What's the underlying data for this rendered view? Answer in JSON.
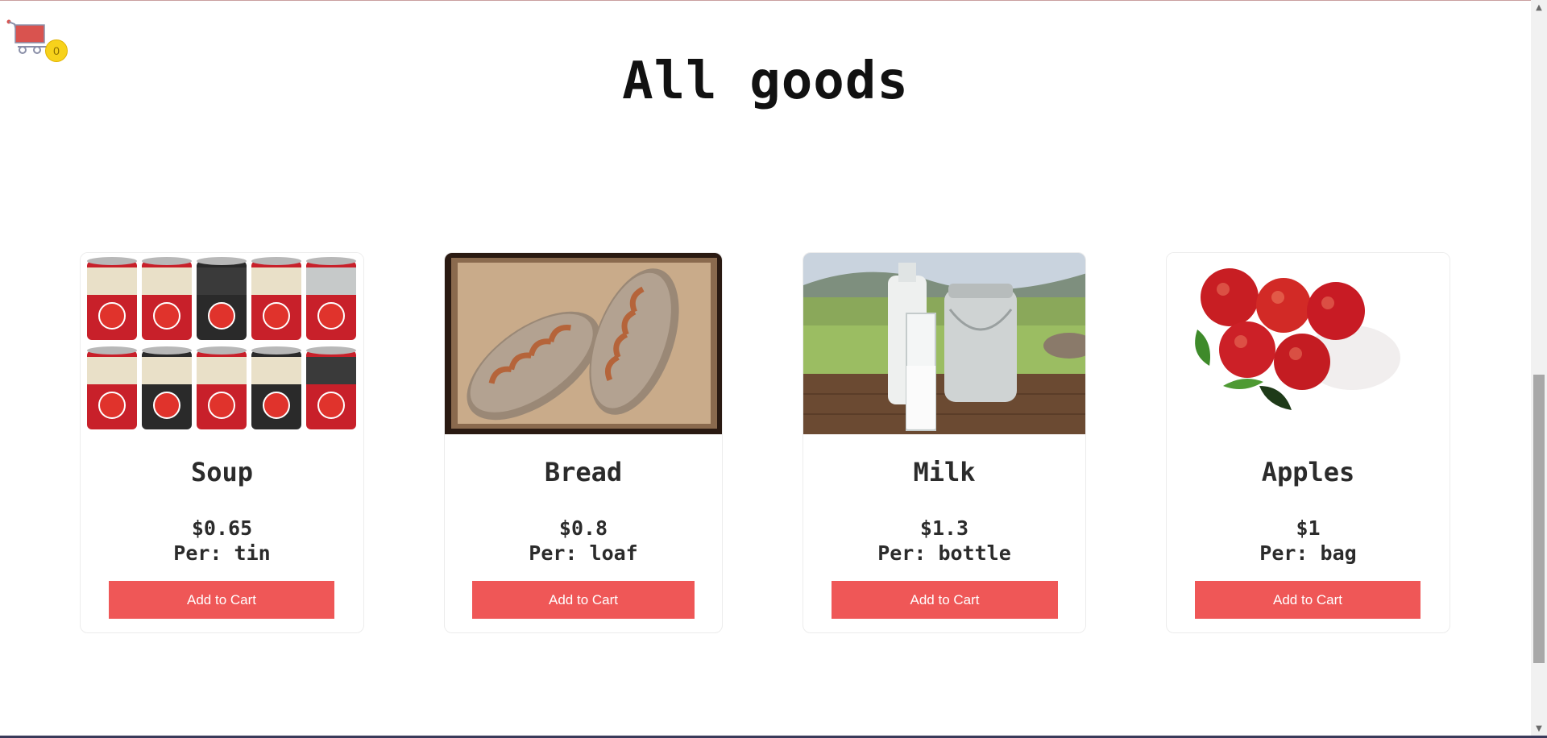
{
  "cart": {
    "count": "0",
    "icon": "shopping-cart-icon"
  },
  "page": {
    "title": "All goods"
  },
  "products": [
    {
      "name": "Soup",
      "price": "$0.65",
      "unit": "Per: tin",
      "button": "Add to Cart",
      "image": "tomato-soup-cans"
    },
    {
      "name": "Bread",
      "price": "$0.8",
      "unit": "Per: loaf",
      "button": "Add to Cart",
      "image": "bread-loaves"
    },
    {
      "name": "Milk",
      "price": "$1.3",
      "unit": "Per: bottle",
      "button": "Add to Cart",
      "image": "milk-bottle-jug"
    },
    {
      "name": "Apples",
      "price": "$1",
      "unit": "Per: bag",
      "button": "Add to Cart",
      "image": "red-apples"
    }
  ],
  "colors": {
    "button": "#ef5757",
    "badge": "#f7d21b"
  }
}
